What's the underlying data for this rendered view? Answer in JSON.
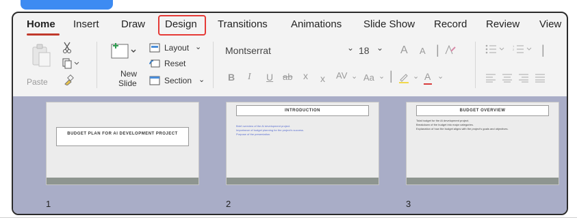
{
  "tabs": [
    "Home",
    "Insert",
    "Draw",
    "Design",
    "Transitions",
    "Animations",
    "Slide Show",
    "Record",
    "Review",
    "View"
  ],
  "clipboard": {
    "paste_label": "Paste"
  },
  "slides_group": {
    "new_slide_line1": "New",
    "new_slide_line2": "Slide",
    "layout_label": "Layout",
    "reset_label": "Reset",
    "section_label": "Section"
  },
  "font": {
    "family": "Montserrat",
    "size": "18",
    "bold": "B",
    "italic": "I",
    "underline": "U",
    "strike": "ab",
    "superscript": "x",
    "subscript": "x",
    "spacing": "AV",
    "change_case": "Aa",
    "grow": "A",
    "shrink": "A",
    "font_color": "A"
  },
  "slides": [
    {
      "number": "1",
      "title": "BUDGET PLAN FOR AI DEVELOPMENT PROJECT",
      "bullets": []
    },
    {
      "number": "2",
      "title": "INTRODUCTION",
      "bullets": [
        "Brief overview of the AI development project.",
        "Importance of budget planning for the project's success.",
        "Purpose of the presentation."
      ]
    },
    {
      "number": "3",
      "title": "BUDGET OVERVIEW",
      "bullets": [
        "Total budget for the AI development project.",
        "Breakdown of the budget into major categories.",
        "Explanation of how the budget aligns with the project's goals and objectives."
      ]
    }
  ],
  "colors": {
    "accent_tab": "#3d8bf2",
    "highlight_box": "#e53935",
    "home_underline": "#c0392b",
    "slide_bullets": "#5a6fd0"
  }
}
